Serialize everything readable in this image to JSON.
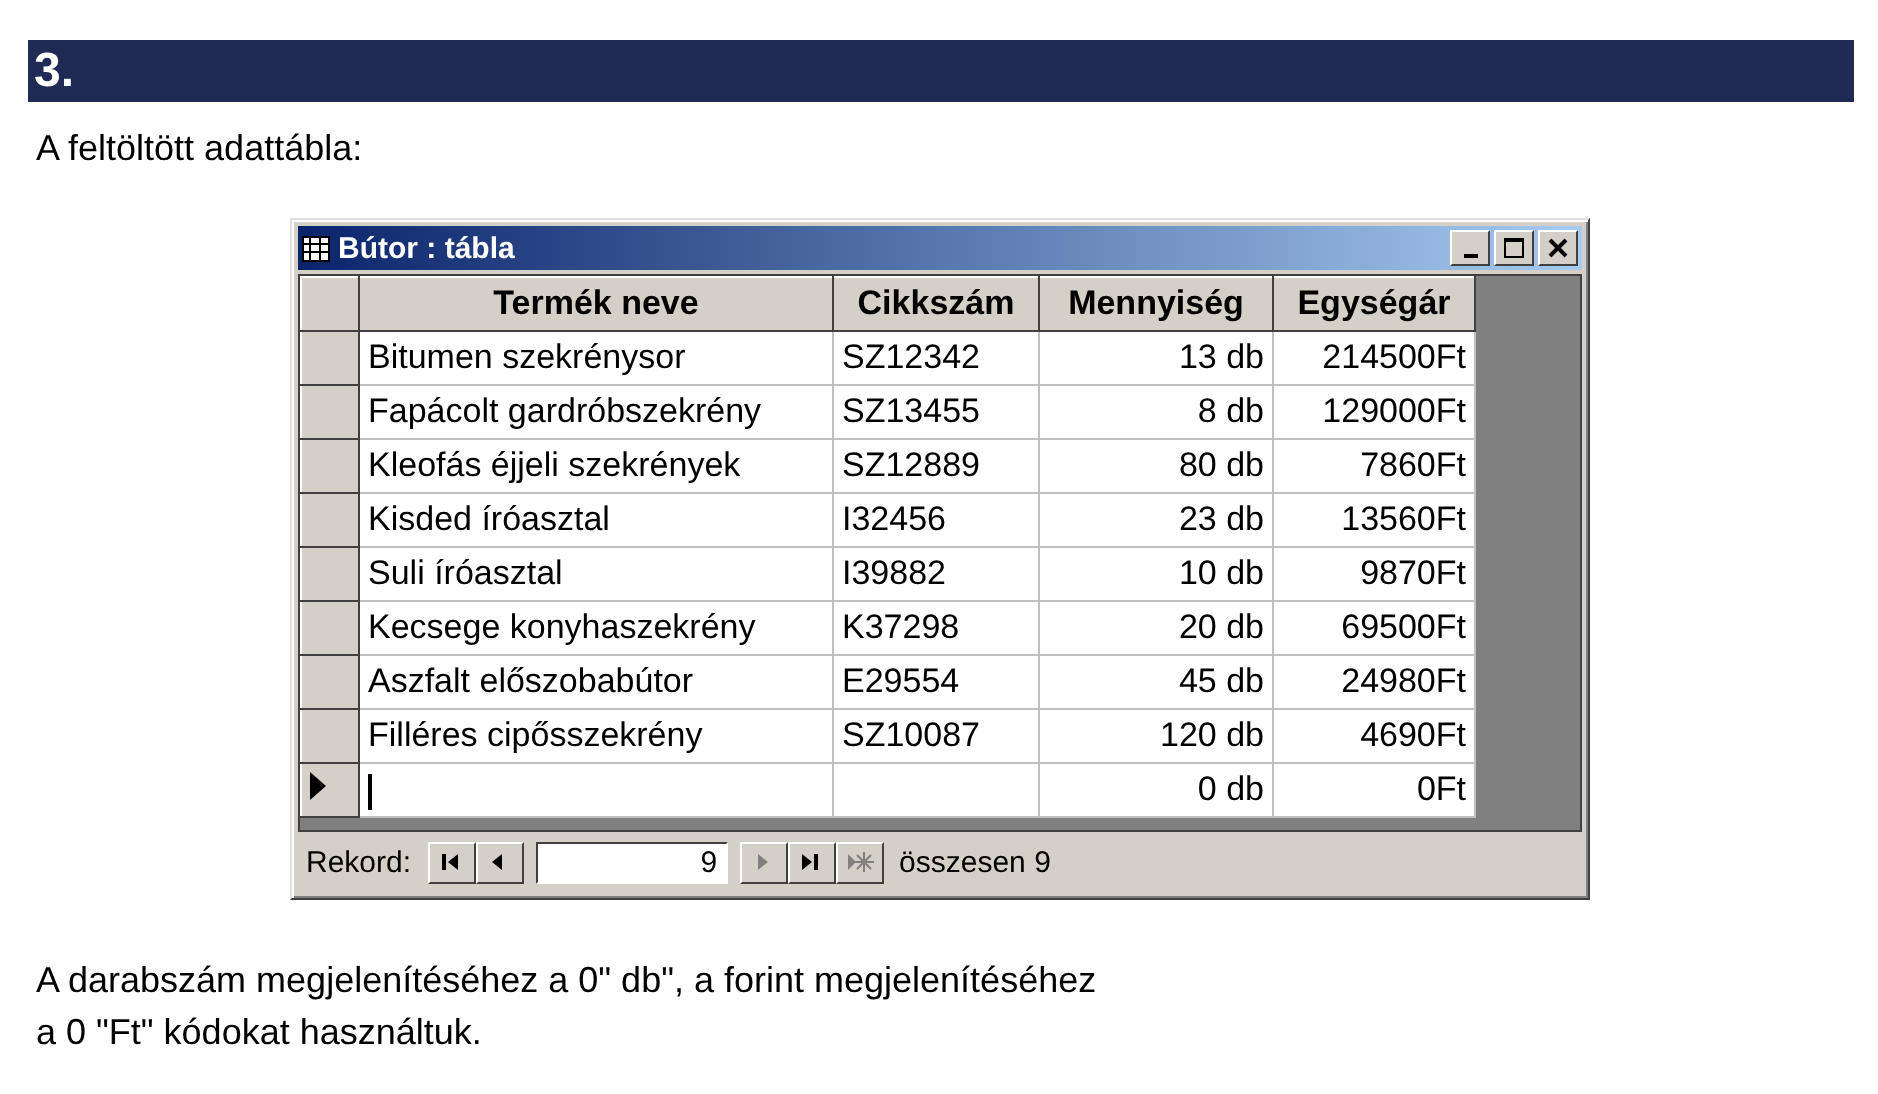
{
  "heading": "3.",
  "intro": "A feltöltött adattábla:",
  "window": {
    "title": "Bútor : tábla",
    "columns": [
      "Termék neve",
      "Cikkszám",
      "Mennyiség",
      "Egységár"
    ],
    "rows": [
      {
        "name": "Bitumen szekrénysor",
        "code": "SZ12342",
        "quantity": "13 db",
        "price": "214500Ft",
        "current": false
      },
      {
        "name": "Fapácolt gardróbszekrény",
        "code": "SZ13455",
        "quantity": "8 db",
        "price": "129000Ft",
        "current": false
      },
      {
        "name": "Kleofás éjjeli szekrények",
        "code": "SZ12889",
        "quantity": "80 db",
        "price": "7860Ft",
        "current": false
      },
      {
        "name": "Kisded íróasztal",
        "code": "I32456",
        "quantity": "23 db",
        "price": "13560Ft",
        "current": false
      },
      {
        "name": "Suli íróasztal",
        "code": "I39882",
        "quantity": "10 db",
        "price": "9870Ft",
        "current": false
      },
      {
        "name": "Kecsege konyhaszekrény",
        "code": "K37298",
        "quantity": "20 db",
        "price": "69500Ft",
        "current": false
      },
      {
        "name": "Aszfalt előszobabútor",
        "code": "E29554",
        "quantity": "45 db",
        "price": "24980Ft",
        "current": false
      },
      {
        "name": "Filléres cipősszekrény",
        "code": "SZ10087",
        "quantity": "120 db",
        "price": "4690Ft",
        "current": false
      },
      {
        "quantity": "0 db",
        "price": "0Ft",
        "current": true
      }
    ],
    "navigator": {
      "label": "Rekord:",
      "record": "9",
      "total": "összesen 9",
      "buttons": [
        {
          "kind": "first",
          "disabled": false
        },
        {
          "kind": "previous",
          "disabled": false
        },
        {
          "kind": "gap"
        },
        {
          "kind": "next",
          "disabled": true
        },
        {
          "kind": "last",
          "disabled": false
        },
        {
          "kind": "new",
          "disabled": true
        }
      ]
    }
  },
  "footnote": [
    "A darabszám megjelenítéséhez a 0\" db\", a forint megjelenítéséhez",
    "a 0 \"Ft\" kódokat használtuk."
  ]
}
